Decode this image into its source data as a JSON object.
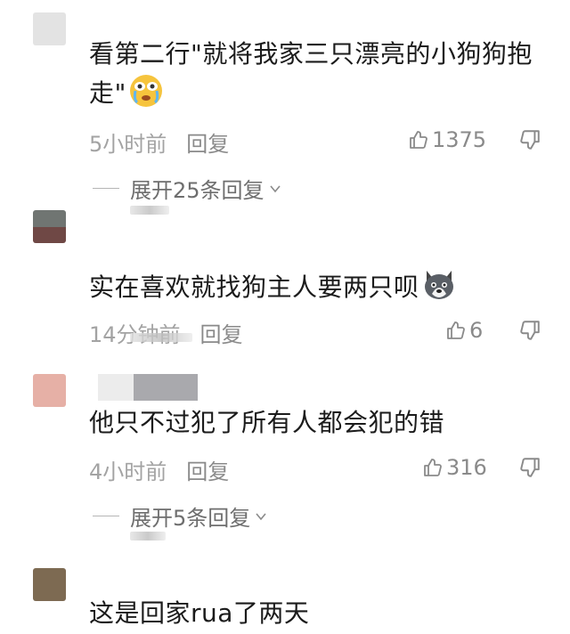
{
  "colors": {
    "text": "#1b1b1b",
    "meta": "#a3a3a3",
    "action": "#8a8a8a",
    "background": "#ffffff"
  },
  "comments": [
    {
      "text": "看第二行\"就将我家三只漂亮的小狗狗抱走\"",
      "emoji": "crying-emoji",
      "time": "5小时前",
      "reply_label": "回复",
      "likes": "1375",
      "expand": "展开25条回复",
      "avatar_colors": [
        "#e3e3e3",
        "#e3e3e3"
      ]
    },
    {
      "text": "实在喜欢就找狗主人要两只呗",
      "emoji": "husky-emoji",
      "time": "14分钟前",
      "reply_label": "回复",
      "likes": "6",
      "avatar_colors": [
        "#707572",
        "#6f4845"
      ]
    },
    {
      "text": "他只不过犯了所有人都会犯的错",
      "time": "4小时前",
      "reply_label": "回复",
      "likes": "316",
      "expand": "展开5条回复",
      "avatar_colors": [
        "#e6b0a6",
        "#e6b0a6"
      ]
    },
    {
      "text": "这是回家rua了两天",
      "avatar_colors": [
        "#7d6a52",
        "#7d6a52"
      ]
    }
  ]
}
